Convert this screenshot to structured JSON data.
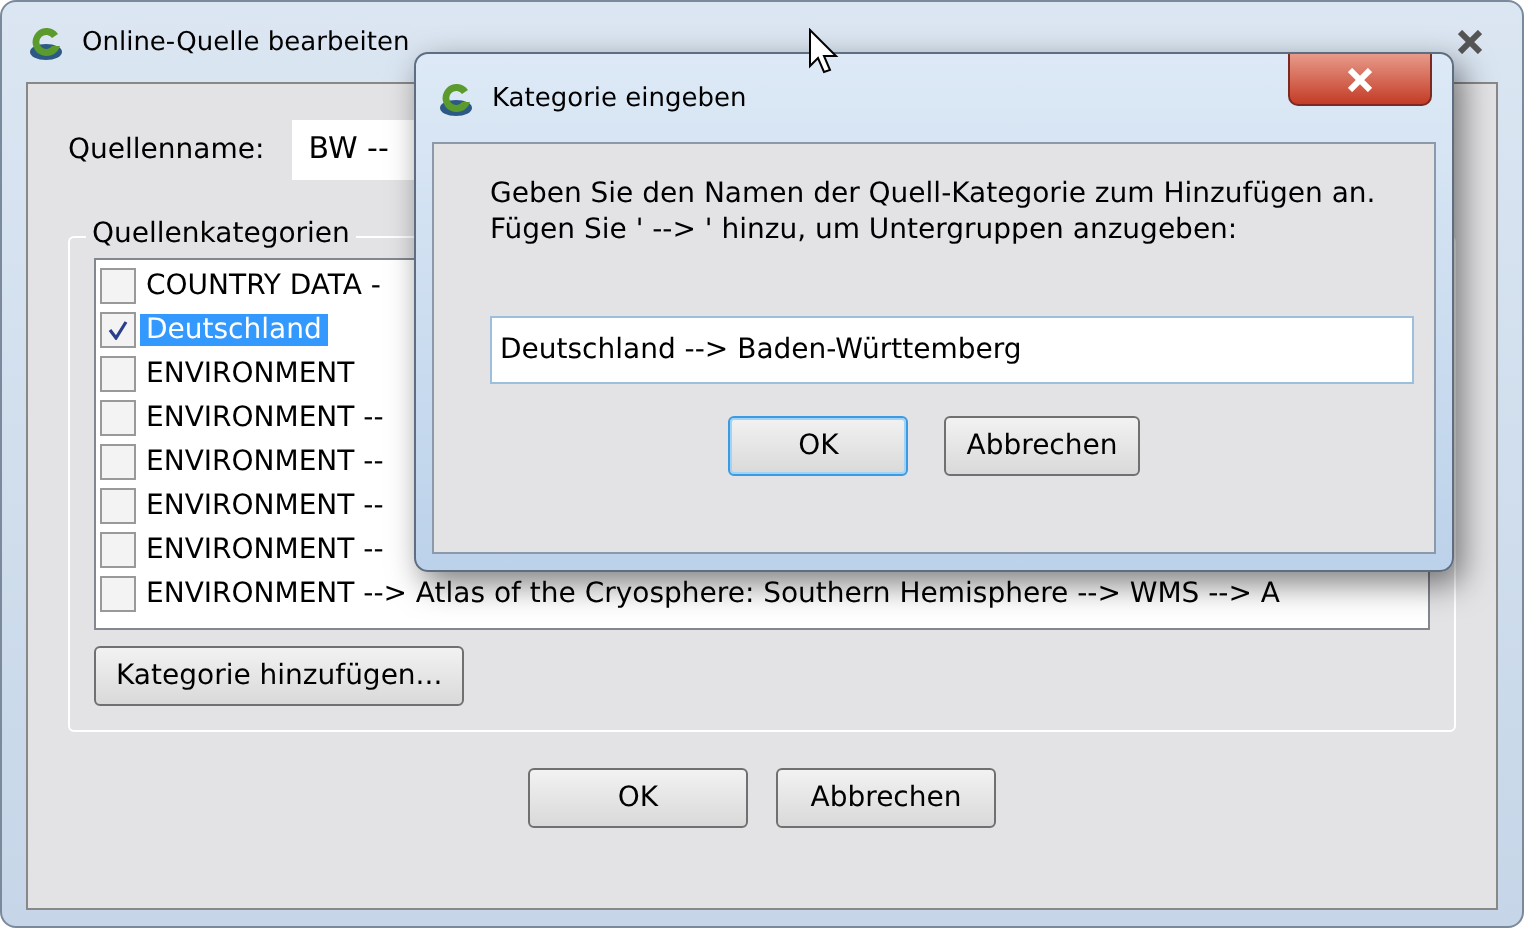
{
  "main_window": {
    "title": "Online-Quelle bearbeiten",
    "source_name_label": "Quellenname:",
    "source_name_value": "BW --",
    "categories_group": "Quellenkategorien",
    "categories": [
      {
        "label": "COUNTRY DATA -",
        "checked": false,
        "selected": false
      },
      {
        "label": "Deutschland",
        "checked": true,
        "selected": true
      },
      {
        "label": "ENVIRONMENT",
        "checked": false,
        "selected": false
      },
      {
        "label": "ENVIRONMENT --",
        "checked": false,
        "selected": false
      },
      {
        "label": "ENVIRONMENT --",
        "checked": false,
        "selected": false
      },
      {
        "label": "ENVIRONMENT --",
        "checked": false,
        "selected": false
      },
      {
        "label": "ENVIRONMENT --",
        "checked": false,
        "selected": false
      },
      {
        "label": "ENVIRONMENT --> Atlas of the Cryosphere: Southern Hemisphere --> WMS --> A",
        "checked": false,
        "selected": false
      }
    ],
    "add_category_button": "Kategorie hinzufügen...",
    "buttons": [
      "OK",
      "Abbrechen"
    ]
  },
  "dialog": {
    "title": "Kategorie eingeben",
    "message": "Geben Sie den Namen der Quell-Kategorie zum Hinzufügen an. Fügen Sie ' --> ' hinzu, um Untergruppen anzugeben:",
    "input_value": "Deutschland --> Baden-Württemberg",
    "buttons": [
      {
        "label": "OK",
        "default": true
      },
      {
        "label": "Abbrechen",
        "default": false
      }
    ]
  }
}
